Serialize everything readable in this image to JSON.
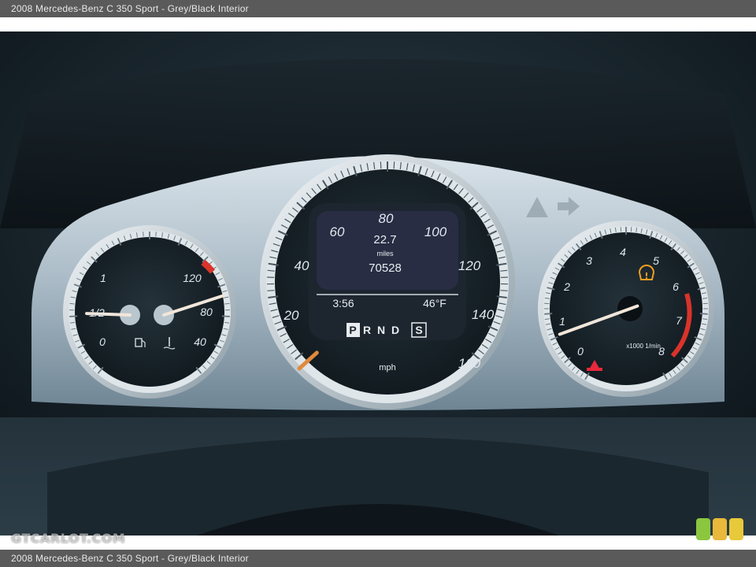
{
  "caption": "2008 Mercedes-Benz C 350 Sport - Grey/Black Interior",
  "watermark": "GTCARLOT.COM",
  "colors": {
    "needle": "#e08a3c",
    "redline": "#d9332a",
    "warning": "#f0a020",
    "parking": "#e8283c"
  },
  "speedometer": {
    "labels": [
      "20",
      "40",
      "60",
      "80",
      "100",
      "120",
      "140",
      "160"
    ],
    "unit": "mph",
    "needle_value_mph": 0
  },
  "display": {
    "avg_value": "22.7",
    "avg_unit": "miles",
    "odometer": "70528",
    "clock": "3:56",
    "outside_temp": "46°F",
    "gear_letters": [
      "P",
      "R",
      "N",
      "D"
    ],
    "gear_selected": "P",
    "mode": "S"
  },
  "fuel_temp_gauge": {
    "fuel_labels": [
      "0",
      "1/2",
      "1"
    ],
    "temp_labels": [
      "40",
      "80",
      "120"
    ],
    "fuel_level_fraction": 0.45,
    "coolant_temp_c": 85
  },
  "tachometer": {
    "labels": [
      "0",
      "1",
      "2",
      "3",
      "4",
      "5",
      "6",
      "7",
      "8"
    ],
    "unit": "x1000 1/min",
    "needle_value_krpm": 0.8
  },
  "icons": [
    "fuel-pump-icon",
    "coolant-temp-icon",
    "tire-pressure-warning-icon",
    "parking-brake-icon",
    "turn-signal-left-icon",
    "turn-signal-right-icon"
  ]
}
